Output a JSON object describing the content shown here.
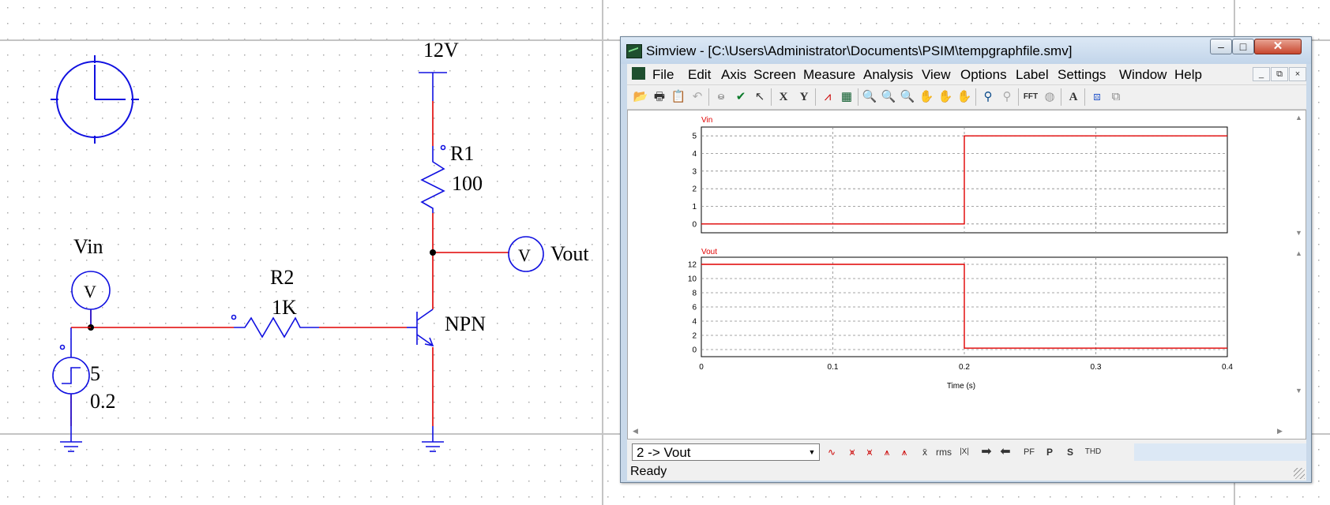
{
  "colors": {
    "wire": "#e00000",
    "component": "#1010e0",
    "grid_dot": "#b0b0b0",
    "waveform": "#e00000"
  },
  "schematic": {
    "vcc_label": "12V",
    "r1": {
      "name": "R1",
      "value": "100"
    },
    "r2": {
      "name": "R2",
      "value": "1K"
    },
    "vout_label": "Vout",
    "vin_label": "Vin",
    "transistor_label": "NPN",
    "voltmeter_symbol": "V",
    "step_source": {
      "amplitude": "5",
      "time": "0.2"
    },
    "icons": [
      "clock-icon",
      "voltmeter-icon",
      "step-source-icon",
      "ground-icon",
      "resistor-icon",
      "npn-transistor-icon"
    ]
  },
  "window": {
    "title": "Simview - [C:\\Users\\Administrator\\Documents\\PSIM\\tempgraphfile.smv]",
    "caption_buttons": {
      "minimize": "–",
      "maximize": "□",
      "close": "✕"
    },
    "menu": [
      "File",
      "Edit",
      "Axis",
      "Screen",
      "Measure",
      "Analysis",
      "View",
      "Options",
      "Label",
      "Settings",
      "Window",
      "Help"
    ],
    "mdi_buttons": [
      "_",
      "⧉",
      "×"
    ],
    "toolbar": [
      "open-icon",
      "print-icon",
      "clipboard-icon",
      "undo-icon",
      "data-icon",
      "check-icon",
      "pointer-icon",
      "x-axis-icon",
      "y-axis-icon",
      "chart-icon",
      "table-icon",
      "zoom-icon",
      "zoom-in-icon",
      "zoom-out-icon",
      "pan-icon",
      "pan-h-icon",
      "pan-v-icon",
      "marker-icon",
      "marker-off-icon",
      "fft-icon",
      "gauge-icon",
      "text-icon",
      "capture-icon",
      "copy-icon"
    ],
    "toolbar_text": {
      "x": "X",
      "y": "Y",
      "fft": "FFT",
      "a": "A"
    },
    "selected_curve": "2 -> Vout",
    "bottom_buttons": {
      "avg": "x̄",
      "rms": "rms",
      "abs": "|X|",
      "pf": "PF",
      "p": "P",
      "s": "S",
      "thd": "THD"
    },
    "status": "Ready"
  },
  "chart_data": [
    {
      "type": "line",
      "title": "Vin",
      "x": [
        0,
        0.2,
        0.2,
        0.4
      ],
      "y": [
        0,
        0,
        5,
        5
      ],
      "xlim": [
        0,
        0.4
      ],
      "ylim": [
        -0.5,
        5.5
      ],
      "yticks": [
        "0",
        "1",
        "2",
        "3",
        "4",
        "5"
      ],
      "grid": true
    },
    {
      "type": "line",
      "title": "Vout",
      "x": [
        0,
        0.2,
        0.2,
        0.4
      ],
      "y": [
        12,
        12,
        0.2,
        0.2
      ],
      "xlim": [
        0,
        0.4
      ],
      "ylim": [
        -1,
        13
      ],
      "yticks": [
        "0",
        "2",
        "4",
        "6",
        "8",
        "10",
        "12"
      ],
      "xticks": [
        "0",
        "0.1",
        "0.2",
        "0.3",
        "0.4"
      ],
      "xlabel": "Time (s)",
      "grid": true
    }
  ]
}
